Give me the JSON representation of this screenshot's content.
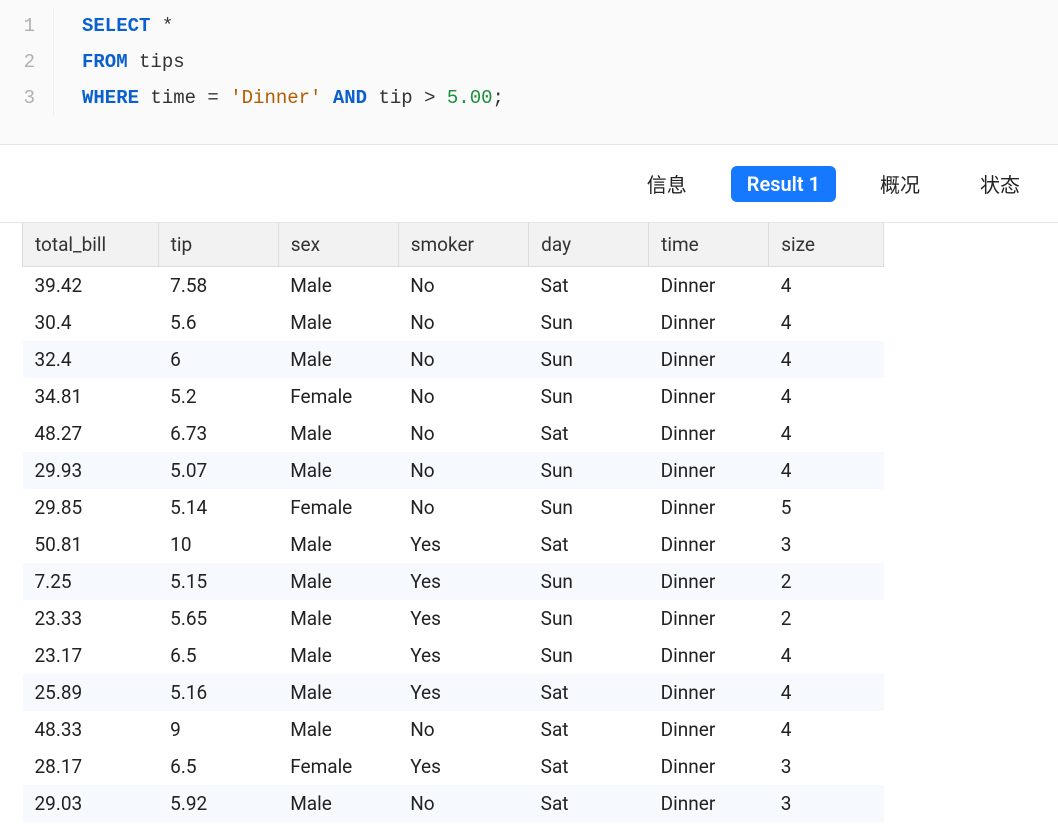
{
  "editor": {
    "lines": [
      {
        "num": "1",
        "tokens": [
          {
            "cls": "kw",
            "t": "SELECT"
          },
          {
            "cls": "punct",
            "t": " *"
          }
        ]
      },
      {
        "num": "2",
        "tokens": [
          {
            "cls": "kw",
            "t": "FROM"
          },
          {
            "cls": "ident",
            "t": " tips"
          }
        ]
      },
      {
        "num": "3",
        "tokens": [
          {
            "cls": "kw",
            "t": "WHERE"
          },
          {
            "cls": "ident",
            "t": " time = "
          },
          {
            "cls": "str",
            "t": "'Dinner'"
          },
          {
            "cls": "ident",
            "t": " "
          },
          {
            "cls": "kw",
            "t": "AND"
          },
          {
            "cls": "ident",
            "t": " tip > "
          },
          {
            "cls": "num",
            "t": "5.00"
          },
          {
            "cls": "punct",
            "t": ";"
          }
        ]
      }
    ]
  },
  "tabs": {
    "info": "信息",
    "result": "Result 1",
    "summary": "概况",
    "status": "状态",
    "active": "result"
  },
  "table": {
    "headers": [
      "total_bill",
      "tip",
      "sex",
      "smoker",
      "day",
      "time",
      "size"
    ],
    "rows": [
      [
        "39.42",
        "7.58",
        "Male",
        "No",
        "Sat",
        "Dinner",
        "4"
      ],
      [
        "30.4",
        "5.6",
        "Male",
        "No",
        "Sun",
        "Dinner",
        "4"
      ],
      [
        "32.4",
        "6",
        "Male",
        "No",
        "Sun",
        "Dinner",
        "4"
      ],
      [
        "34.81",
        "5.2",
        "Female",
        "No",
        "Sun",
        "Dinner",
        "4"
      ],
      [
        "48.27",
        "6.73",
        "Male",
        "No",
        "Sat",
        "Dinner",
        "4"
      ],
      [
        "29.93",
        "5.07",
        "Male",
        "No",
        "Sun",
        "Dinner",
        "4"
      ],
      [
        "29.85",
        "5.14",
        "Female",
        "No",
        "Sun",
        "Dinner",
        "5"
      ],
      [
        "50.81",
        "10",
        "Male",
        "Yes",
        "Sat",
        "Dinner",
        "3"
      ],
      [
        "7.25",
        "5.15",
        "Male",
        "Yes",
        "Sun",
        "Dinner",
        "2"
      ],
      [
        "23.33",
        "5.65",
        "Male",
        "Yes",
        "Sun",
        "Dinner",
        "2"
      ],
      [
        "23.17",
        "6.5",
        "Male",
        "Yes",
        "Sun",
        "Dinner",
        "4"
      ],
      [
        "25.89",
        "5.16",
        "Male",
        "Yes",
        "Sat",
        "Dinner",
        "4"
      ],
      [
        "48.33",
        "9",
        "Male",
        "No",
        "Sat",
        "Dinner",
        "4"
      ],
      [
        "28.17",
        "6.5",
        "Female",
        "Yes",
        "Sat",
        "Dinner",
        "3"
      ],
      [
        "29.03",
        "5.92",
        "Male",
        "No",
        "Sat",
        "Dinner",
        "3"
      ]
    ]
  }
}
